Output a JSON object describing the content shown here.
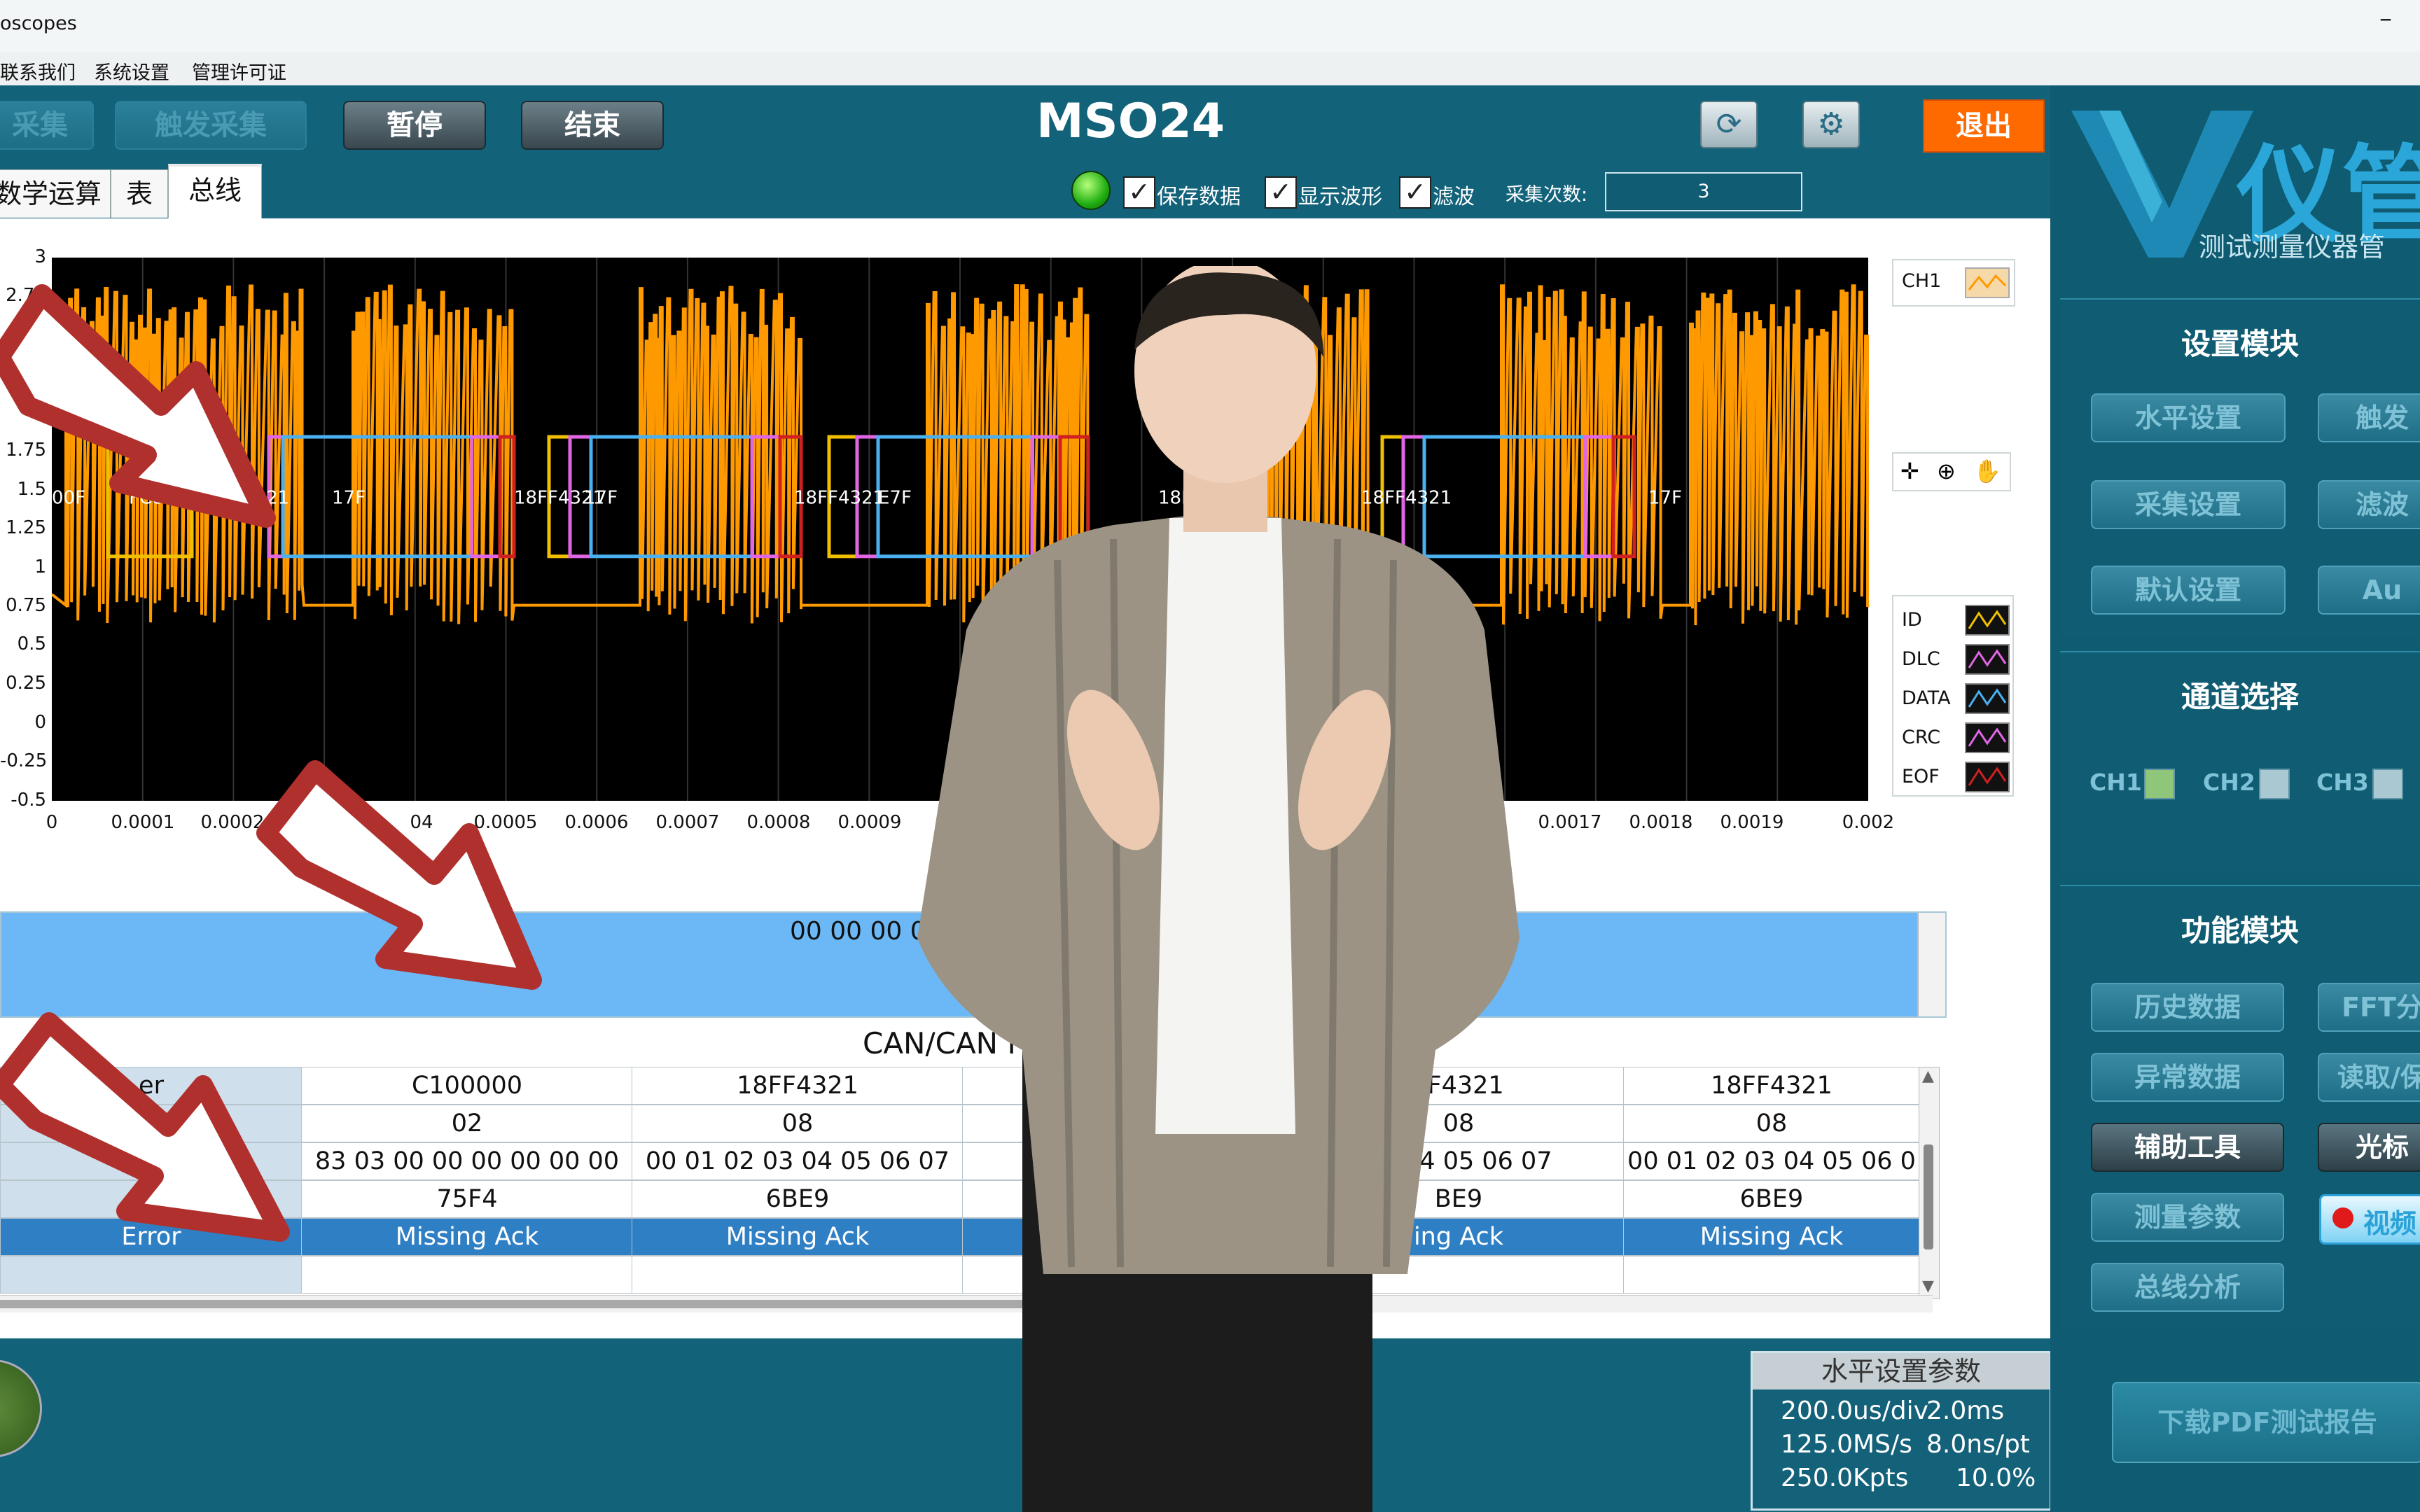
{
  "window": {
    "title": "oscopes"
  },
  "menu": [
    "联系我们",
    "系统设置",
    "管理许可证"
  ],
  "toolbar": {
    "buttons": [
      "采集",
      "触发采集",
      "暂停",
      "结束"
    ],
    "device": "MSO24",
    "exit": "退出"
  },
  "tabs": [
    "数学运算",
    "表",
    "总线"
  ],
  "options": {
    "save_data": "保存数据",
    "show_wave": "显示波形",
    "filter": "滤波",
    "count_label": "采集次数:",
    "count_value": "3"
  },
  "plot": {
    "channel_legend": "CH1",
    "legend": [
      "ID",
      "DLC",
      "DATA",
      "CRC",
      "EOF"
    ],
    "colors": {
      "wave": "#ff9900",
      "ID": "#f0c000",
      "DLC": "#e066e6",
      "DATA": "#4ab0f0",
      "CRC": "#e066e6",
      "EOF": "#d02020"
    },
    "y_ticks": [
      "3",
      "2.75",
      "1.75",
      "1.5",
      "1.25",
      "1",
      "0.75",
      "0.5",
      "0.25",
      "0",
      "-0.25",
      "-0.5"
    ],
    "x_ticks": [
      "0",
      "0.0001",
      "0.0002",
      "04",
      "0.0005",
      "0.0006",
      "0.0007",
      "0.0008",
      "0.0009",
      "16",
      "0.0017",
      "0.0018",
      "0.0019",
      "0.002"
    ],
    "frame_labels": [
      "00F",
      "FC80F",
      "18FF4321",
      "17F",
      "18FF4321",
      "17F",
      "18FF4321",
      "E7F",
      "18FF4321",
      "18FF4321",
      "17F"
    ]
  },
  "decoded_text": "00 00 00 0",
  "table": {
    "title": "CAN/CAN F",
    "row_labels": [
      "er",
      "",
      "DA",
      "CR",
      "Error",
      ""
    ],
    "columns": [
      {
        "id": "C100000",
        "dlc": "02",
        "data": "83 03 00 00 00 00 00 00",
        "crc": "75F4",
        "error": "Missing Ack"
      },
      {
        "id": "18FF4321",
        "dlc": "08",
        "data": "00 01 02 03 04 05 06 07",
        "crc": "6BE9",
        "error": "Missing Ack"
      },
      {
        "id": "",
        "dlc": "",
        "data": "00",
        "crc": "",
        "error": ""
      },
      {
        "id": "FF4321",
        "dlc": "08",
        "data": "03 04 05 06 07",
        "crc": "BE9",
        "error": "ing Ack"
      },
      {
        "id": "18FF4321",
        "dlc": "08",
        "data": "00 01 02 03 04 05 06 0",
        "crc": "6BE9",
        "error": "Missing Ack"
      }
    ]
  },
  "hparams": {
    "title": "水平设置参数",
    "rows": [
      [
        "200.0us/div",
        "2.0ms"
      ],
      [
        "125.0MS/s",
        "8.0ns/pt"
      ],
      [
        "250.0Kpts",
        "10.0%"
      ]
    ]
  },
  "right_panel": {
    "logo_text": "仪管",
    "logo_sub": "测试测量仪器管",
    "settings": {
      "title": "设置模块",
      "buttons": [
        "水平设置",
        "触发",
        "采集设置",
        "滤波",
        "默认设置",
        "Au"
      ]
    },
    "channels": {
      "title": "通道选择",
      "items": [
        "CH1",
        "CH2",
        "CH3"
      ]
    },
    "functions": {
      "title": "功能模块",
      "buttons": [
        "历史数据",
        "FFT分",
        "异常数据",
        "读取/保",
        "辅助工具",
        "光标",
        "测量参数",
        "视频",
        "总线分析"
      ]
    },
    "pdf": "下载PDF测试报告"
  }
}
